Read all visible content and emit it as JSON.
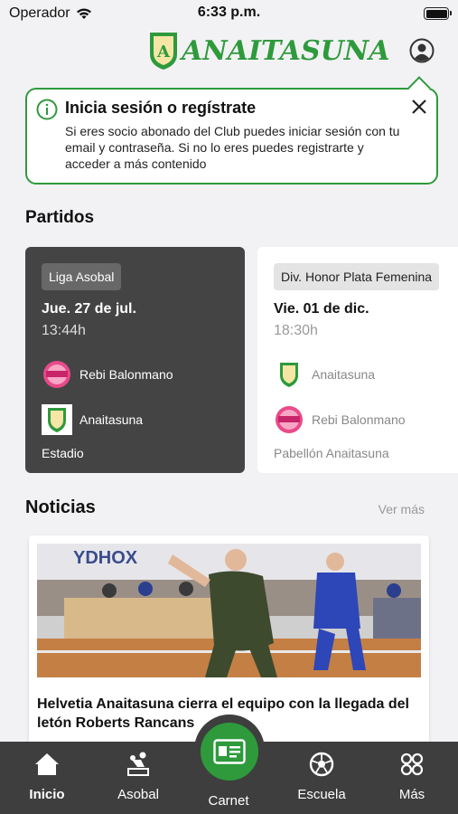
{
  "status_bar": {
    "carrier": "Operador",
    "time": "6:33 p.m."
  },
  "header": {
    "logo_text": "ANAITASUNA",
    "crest_letter": "A"
  },
  "login_banner": {
    "title": "Inicia sesión o regístrate",
    "body": "Si eres socio abonado del Club puedes iniciar sesión con tu email y contraseña. Si no lo eres puedes registrarte y acceder a más contenido"
  },
  "partidos": {
    "title": "Partidos",
    "matches": [
      {
        "competition": "Liga Asobal",
        "date": "Jue. 27 de jul.",
        "time": "13:44h",
        "home_team": "Rebi Balonmano",
        "away_team": "Anaitasuna",
        "venue": "Estadio"
      },
      {
        "competition": "Div. Honor  Plata Femenina",
        "date": "Vie. 01 de dic.",
        "time": "18:30h",
        "home_team": "Anaitasuna",
        "away_team": "Rebi Balonmano",
        "venue": "Pabellón Anaitasuna"
      }
    ]
  },
  "noticias": {
    "title": "Noticias",
    "ver_mas": "Ver más",
    "items": [
      {
        "title": "Helvetia Anaitasuna cierra el equipo con la llegada del letón Roberts Rancans",
        "image_text": "YDHOX"
      }
    ]
  },
  "tab_bar": {
    "tabs": [
      {
        "label": "Inicio",
        "icon": "home-icon"
      },
      {
        "label": "Asobal",
        "icon": "handball-icon"
      },
      {
        "label": "Carnet",
        "icon": "id-card-icon"
      },
      {
        "label": "Escuela",
        "icon": "ball-icon"
      },
      {
        "label": "Más",
        "icon": "grid-icon"
      }
    ]
  },
  "colors": {
    "brand_green": "#2e9a3c",
    "card_dark": "#444444",
    "tab_bar": "#3e3e3e"
  }
}
